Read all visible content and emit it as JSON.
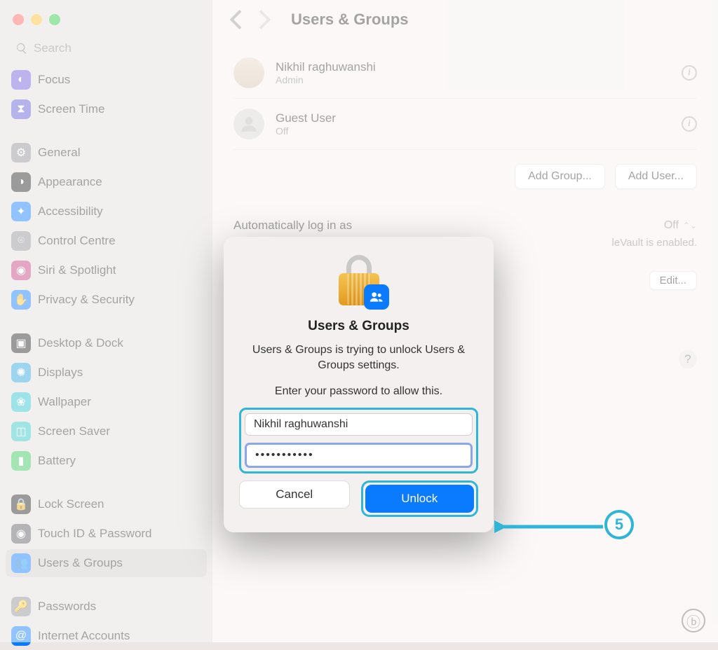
{
  "search": {
    "placeholder": "Search"
  },
  "sidebar": {
    "items": [
      {
        "label": "Focus",
        "color": "#6e58d9",
        "glyph": "◐"
      },
      {
        "label": "Screen Time",
        "color": "#5b57d6",
        "glyph": "⧗"
      },
      {
        "label": "General",
        "color": "#8e8e93",
        "glyph": "⚙"
      },
      {
        "label": "Appearance",
        "color": "#232325",
        "glyph": "◑"
      },
      {
        "label": "Accessibility",
        "color": "#0a7aff",
        "glyph": "✦"
      },
      {
        "label": "Control Centre",
        "color": "#8e8e93",
        "glyph": "⌾"
      },
      {
        "label": "Siri & Spotlight",
        "color": "#c23a7a",
        "glyph": "◉"
      },
      {
        "label": "Privacy & Security",
        "color": "#0a7aff",
        "glyph": "✋"
      },
      {
        "label": "Desktop & Dock",
        "color": "#232325",
        "glyph": "▣"
      },
      {
        "label": "Displays",
        "color": "#26a0da",
        "glyph": "✺"
      },
      {
        "label": "Wallpaper",
        "color": "#26c1c9",
        "glyph": "❀"
      },
      {
        "label": "Screen Saver",
        "color": "#2ec5c0",
        "glyph": "◫"
      },
      {
        "label": "Battery",
        "color": "#34c759",
        "glyph": "▮"
      },
      {
        "label": "Lock Screen",
        "color": "#232325",
        "glyph": "🔒"
      },
      {
        "label": "Touch ID & Password",
        "color": "#5a5a5e",
        "glyph": "◉"
      },
      {
        "label": "Users & Groups",
        "color": "#0a7aff",
        "glyph": "👥"
      },
      {
        "label": "Passwords",
        "color": "#8e8e93",
        "glyph": "🔑"
      },
      {
        "label": "Internet Accounts",
        "color": "#0a7aff",
        "glyph": "@"
      }
    ]
  },
  "header": {
    "title": "Users & Groups"
  },
  "users": [
    {
      "name": "Nikhil raghuwanshi",
      "role": "Admin"
    },
    {
      "name": "Guest User",
      "role": "Off"
    }
  ],
  "buttons": {
    "addGroup": "Add Group...",
    "addUser": "Add User..."
  },
  "autoLogin": {
    "label": "Automatically log in as",
    "value": "Off",
    "sub": "leVault is enabled."
  },
  "networkServer": {
    "edit": "Edit..."
  },
  "dialog": {
    "title": "Users & Groups",
    "message": "Users & Groups is trying to unlock Users & Groups settings.",
    "hint": "Enter your password to allow this.",
    "username": "Nikhil raghuwanshi",
    "password": "•••••••••••",
    "cancel": "Cancel",
    "unlock": "Unlock"
  },
  "annotation": {
    "step": "5"
  }
}
